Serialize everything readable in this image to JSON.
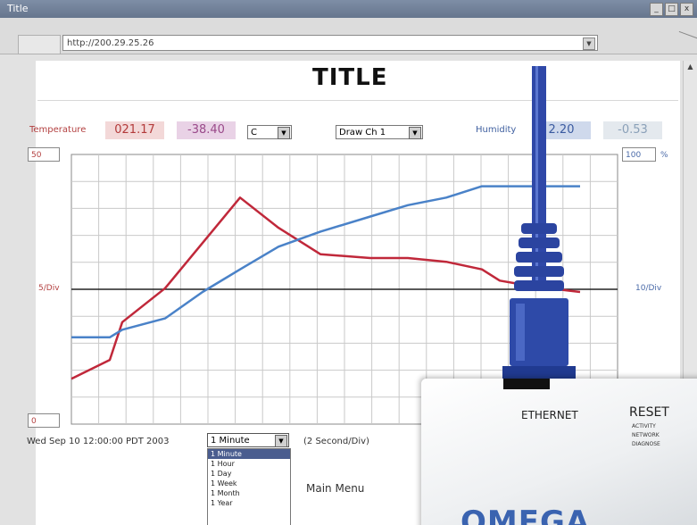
{
  "window": {
    "title": "Title",
    "minimize": "_",
    "maximize": "□",
    "close": "x"
  },
  "addressbar": {
    "url": "http://200.29.25.26",
    "drop": "▼"
  },
  "page": {
    "title": "TITLE",
    "temperature_label": "Temperature",
    "temperature_value": "021.17",
    "temperature_value2": "-38.40",
    "unit_select": "C",
    "channel_select": "Draw Ch 1",
    "humidity_label": "Humidity",
    "humidity_value": "2.20",
    "humidity_value2": "-0.53",
    "left_top": "50",
    "left_mid": "5/Div",
    "left_bottom": "0",
    "right_top": "100",
    "right_unit": "%",
    "right_mid": "10/Div",
    "timestamp": "Wed Sep 10 12:00:00 PDT 2003",
    "interval_select": "1 Minute",
    "interval_options": [
      "1 Minute",
      "1 Hour",
      "1 Day",
      "1 Week",
      "1 Month",
      "1 Year"
    ],
    "rate": "(2 Second/Div)",
    "main_menu": "Main Menu",
    "scroll_up": "▲"
  },
  "device": {
    "ethernet_label": "ETHERNET",
    "reset_label": "RESET",
    "led1": "ACTIVITY",
    "led2": "NETWORK",
    "led3": "DIAGNOSE",
    "brand": "OMEGA"
  },
  "colors": {
    "temperature_line": "#c0283a",
    "humidity_line": "#4a82c8",
    "midline": "#222222",
    "grid": "#c9c9c9",
    "cable": "#2f48a8",
    "temp_box": "#f3d8d8",
    "temp_box2": "#e9d2e6",
    "hum_box": "#cfd9ec",
    "hum_box2": "#e4e9ee"
  },
  "chart_data": {
    "type": "line",
    "grid": true,
    "series": [
      {
        "values": [
          12,
          17,
          27,
          36,
          48,
          60,
          52,
          45,
          44,
          44,
          43,
          41,
          38,
          37,
          36,
          35
        ]
      },
      {
        "values": [
          23,
          23,
          25,
          28,
          35,
          41,
          47,
          51,
          55,
          58,
          60,
          63,
          63,
          63,
          63,
          63
        ]
      }
    ]
  }
}
